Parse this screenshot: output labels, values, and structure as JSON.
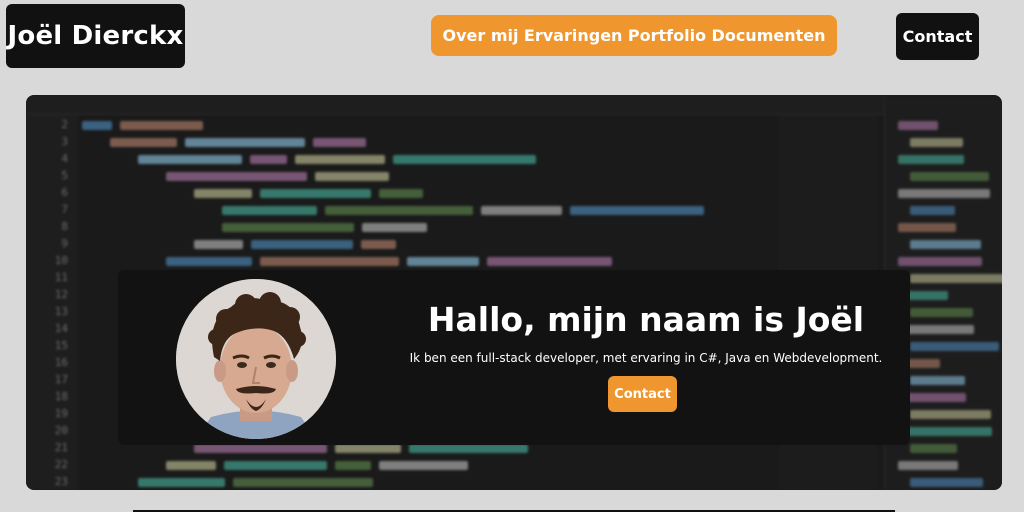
{
  "header": {
    "brand": "Joël Dierckx",
    "nav": [
      "Over mij",
      "Ervaringen",
      "Portfolio",
      "Documenten"
    ],
    "contact_label": "Contact"
  },
  "hero": {
    "title": "Hallo, mijn naam is Joël",
    "subtitle": "Ik ben een full-stack developer, met ervaring in C#, Java en Webdevelopment.",
    "contact_label": "Contact"
  },
  "colors": {
    "accent": "#f0962f",
    "dark": "#111111",
    "page_bg": "#d9d9d9"
  }
}
